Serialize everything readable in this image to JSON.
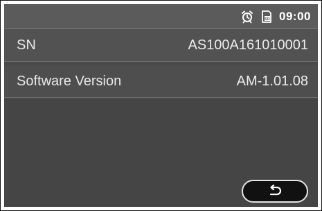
{
  "statusbar": {
    "icons": [
      "alarm-clock-icon",
      "sd-card-icon"
    ],
    "time": "09:00"
  },
  "info": {
    "rows": [
      {
        "label": "SN",
        "value": "AS100A161010001"
      },
      {
        "label": "Software Version",
        "value": "AM-1.01.08"
      }
    ]
  },
  "footer": {
    "back_icon": "return-arrow-icon"
  },
  "colors": {
    "screen_bg": "#4a4a4a",
    "statusbar_bg": "#5b5b5b",
    "text": "#e8e8e8",
    "button_bg": "#111111",
    "button_border": "#e6e6e6"
  }
}
